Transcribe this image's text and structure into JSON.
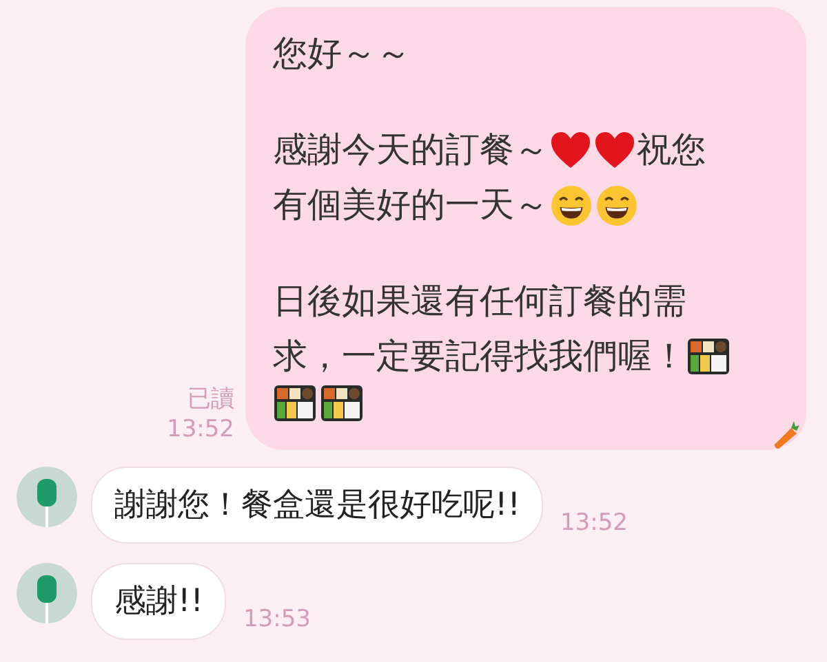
{
  "sent_message": {
    "receipt": {
      "read_label": "已讀",
      "time": "13:52"
    },
    "paragraphs": [
      {
        "lines": [
          [
            {
              "kind": "text",
              "text": "您好～～"
            }
          ]
        ]
      },
      {
        "lines": [
          [
            {
              "kind": "text",
              "text": "感謝今天的訂餐～"
            },
            {
              "kind": "heart"
            },
            {
              "kind": "heart"
            },
            {
              "kind": "text",
              "text": "祝您"
            }
          ],
          [
            {
              "kind": "text",
              "text": "有個美好的一天～"
            },
            {
              "kind": "grin"
            },
            {
              "kind": "grin"
            }
          ]
        ]
      },
      {
        "lines": [
          [
            {
              "kind": "text",
              "text": "日後如果還有任何訂餐的需"
            }
          ],
          [
            {
              "kind": "text",
              "text": "求，一定要記得找我們喔！"
            },
            {
              "kind": "bento"
            }
          ],
          [
            {
              "kind": "bento"
            },
            {
              "kind": "bento"
            }
          ]
        ]
      }
    ]
  },
  "received_messages": [
    {
      "text": "謝謝您！餐盒還是很好吃呢!!",
      "time": "13:52"
    },
    {
      "text": "感謝!!",
      "time": "13:53"
    }
  ]
}
